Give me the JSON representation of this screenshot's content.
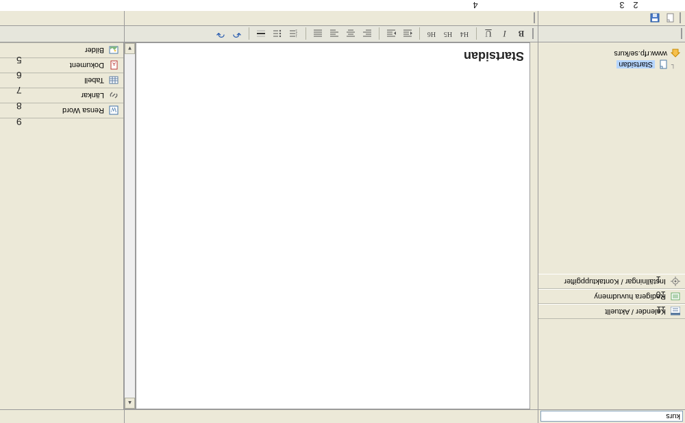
{
  "header": {
    "search_value": "kurs"
  },
  "left_panel": {
    "options": [
      {
        "label": "Kalender / Aktuellt",
        "icon": "calendar-icon"
      },
      {
        "label": "Redigera huvudmeny",
        "icon": "edit-menu-icon"
      },
      {
        "label": "Inställningar / Kontaktuppgifter",
        "icon": "gear-icon"
      }
    ],
    "tree": {
      "root_label": "www.rfp.se/kurs",
      "root_icon": "home-icon",
      "child_label": "Startsidan",
      "child_icon": "page-icon"
    }
  },
  "editor": {
    "page_title": "Startsidan",
    "buttons": {
      "bold": "B",
      "italic": "I",
      "underline": "U",
      "h4": "H4",
      "h5": "H5",
      "h6": "H6",
      "undo": "↶",
      "redo": "↷"
    }
  },
  "right_panel": {
    "items": [
      {
        "label": "Rensa Word",
        "icon": "word-icon"
      },
      {
        "label": "Länkar",
        "icon": "link-icon"
      },
      {
        "label": "Tabell",
        "icon": "table-icon"
      },
      {
        "label": "Dokument",
        "icon": "document-icon"
      },
      {
        "label": "Bilder",
        "icon": "image-icon"
      }
    ]
  },
  "icon_toolbar": {
    "new_icon": "new-doc-icon",
    "save_icon": "save-icon"
  },
  "callouts": {
    "left_opts": [
      "11",
      "10",
      "1"
    ],
    "bottom": {
      "n2": "2",
      "n3": "3",
      "n4": "4"
    },
    "right": {
      "n5": "5",
      "n6": "6",
      "n7": "7",
      "n8": "8",
      "n9": "9"
    }
  }
}
